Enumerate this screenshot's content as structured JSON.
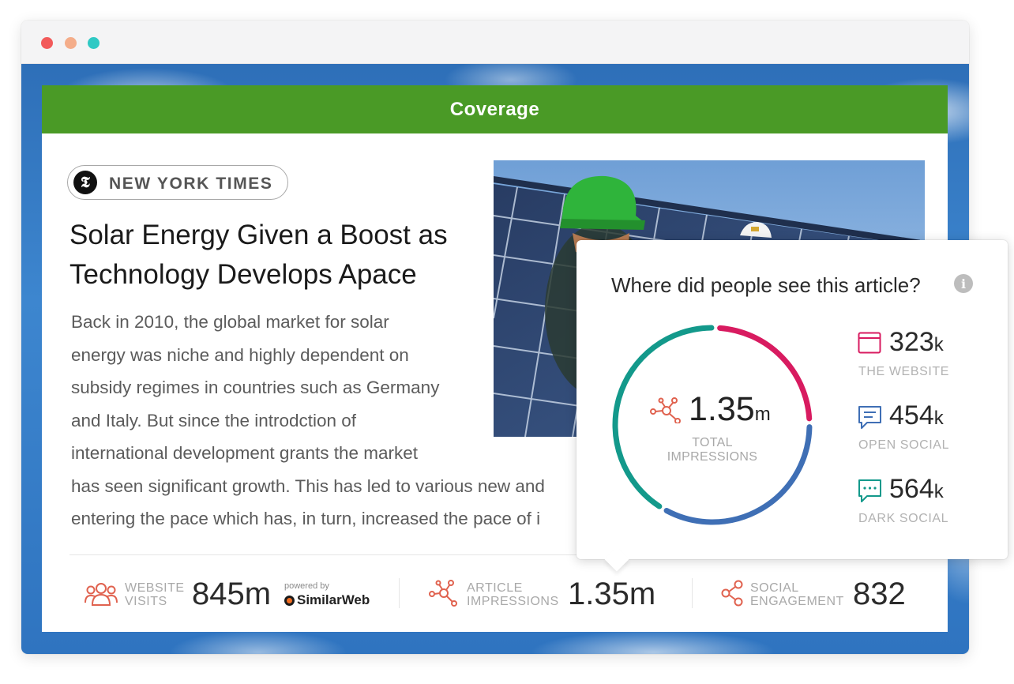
{
  "window": {
    "controls": [
      "close",
      "minimize",
      "zoom"
    ]
  },
  "card": {
    "title": "Coverage",
    "source": {
      "logo_letter": "𝕿",
      "name": "NEW YORK TIMES"
    },
    "headline_lines": [
      "Solar Energy Given a Boost as",
      "Technology Develops Apace"
    ],
    "body_lines": [
      "Back in 2010, the global market for solar",
      "energy was niche and highly dependent on",
      "subsidy regimes in countries such as Germany",
      "and Italy. But since the introdction of",
      "international development grants the market",
      "has seen significant growth. This has led to various new and",
      "entering the pace which has, in turn, increased the pace of i"
    ]
  },
  "stats": {
    "website": {
      "label_1": "WEBSITE",
      "label_2": "VISITS",
      "value": "845m",
      "powered_by": "powered by",
      "provider": "SimilarWeb"
    },
    "impressions": {
      "label_1": "ARTICLE",
      "label_2": "IMPRESSIONS",
      "value": "1.35m"
    },
    "social": {
      "label_1": "SOCIAL",
      "label_2": "ENGAGEMENT",
      "value": "832"
    }
  },
  "popup": {
    "title": "Where did people see this article?",
    "info_icon": "i",
    "total": {
      "number": "1.35",
      "unit": "m",
      "label_1": "TOTAL",
      "label_2": "IMPRESSIONS"
    },
    "channels": [
      {
        "number": "323",
        "unit": "k",
        "label": "THE WEBSITE",
        "color": "#d81b60",
        "icon": "browser-icon"
      },
      {
        "number": "454",
        "unit": "k",
        "label": "OPEN SOCIAL",
        "color": "#3f6fb5",
        "icon": "chat-icon"
      },
      {
        "number": "564",
        "unit": "k",
        "label": "DARK SOCIAL",
        "color": "#13998b",
        "icon": "chat-dots-icon"
      }
    ]
  },
  "colors": {
    "header_green": "#4a9a26",
    "accent_red": "#e0624f",
    "website_pink": "#d81b60",
    "open_social_blue": "#3f6fb5",
    "dark_social_teal": "#13998b"
  }
}
